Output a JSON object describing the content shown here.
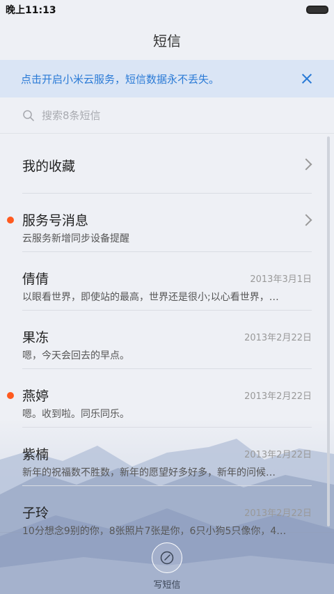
{
  "status": {
    "time": "晚上11:13"
  },
  "header": {
    "title": "短信"
  },
  "banner": {
    "text": "点击开启小米云服务，短信数据永不丢失。"
  },
  "search": {
    "placeholder": "搜索8条短信"
  },
  "favorites": {
    "label": "我的收藏"
  },
  "conversations": [
    {
      "name": "服务号消息",
      "preview": "云服务新增同步设备提醒",
      "date": "",
      "unread": true,
      "chevron": true
    },
    {
      "name": "倩倩",
      "preview": "以眼看世界，即使站的最高，世界还是很小;以心看世界，…",
      "date": "2013年3月1日",
      "unread": false,
      "chevron": false
    },
    {
      "name": "果冻",
      "preview": "嗯，今天会回去的早点。",
      "date": "2013年2月22日",
      "unread": false,
      "chevron": false
    },
    {
      "name": "燕婷",
      "preview": "嗯。收到啦。同乐同乐。",
      "date": "2013年2月22日",
      "unread": true,
      "chevron": false
    },
    {
      "name": "紫楠",
      "preview": "新年的祝福数不胜数，新年的愿望好多好多，新年的问候…",
      "date": "2013年2月22日",
      "unread": false,
      "chevron": false
    },
    {
      "name": "子玲",
      "preview": "10分想念9别的你，8张照片7张是你，6只小狗5只像你，4…",
      "date": "2013年2月22日",
      "unread": false,
      "chevron": false
    }
  ],
  "compose": {
    "label": "写短信"
  },
  "colors": {
    "accent": "#2a7ad6",
    "unread": "#ff5a1f",
    "banner_bg": "#dae5f5"
  }
}
